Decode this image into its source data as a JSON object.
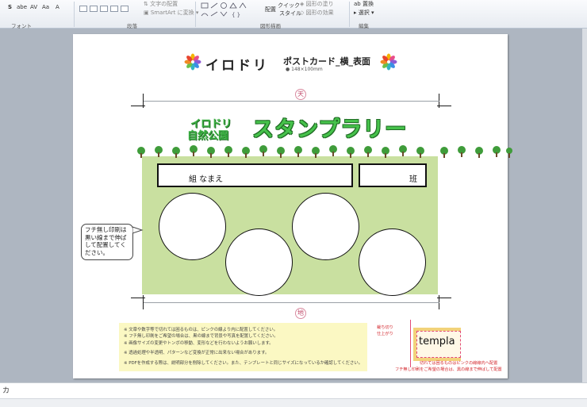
{
  "ribbon": {
    "font_group_label": "フォント",
    "paragraph_group_label": "段落",
    "drawing_group_label": "図形描画",
    "editing_group_label": "編集",
    "text_direction": "文字の配置",
    "smartart": "SmartArt に変換",
    "arrange": "配置",
    "quick_style": "クイック",
    "style_word": "スタイル",
    "shape_fill": "図形の塗り",
    "shape_outline": "図形の枠線",
    "shape_effect": "図形の効果",
    "find": "置換",
    "select": "選択"
  },
  "slide": {
    "brand": "イロドリ",
    "product": "ポストカード_横_表面",
    "size": "148×100mm",
    "top_mark": "天",
    "bottom_mark": "地",
    "park_name_top": "イロドリ",
    "park_name_bottom": "自然公園",
    "rally_title": "スタンプラリー",
    "name_field": "組 なまえ",
    "class_field": "班",
    "borderless_note": "フチ無し印刷は黒い線まで伸ばして配置してください。",
    "notes": [
      "※ 文章や数字等で切れては困るものは、ピンクの線より内に配置してください。",
      "※ フチ無し印刷をご希望の場合は、黒の線まで背景や写真を配置してください。",
      "※ 画像サイズの変更やトンボの移動、変形などを行わないようお願いします。",
      "※ 透過処理や半透明、パターンなど変換が正常に出来ない場合があります。",
      "※ PDFを作成する際は、説明部分を削除してください。また、テンプレートと同じサイズになっているか確認してください。"
    ],
    "template_word": "templa",
    "legend_cut": "裁ち切り",
    "legend_finish": "仕上がり",
    "legend_safe": "切れては困るものはピンクの線線内へ配置",
    "legend_borderless": "フチ無し印刷をご希望の場合は、黒の線まで伸ばして配置"
  },
  "status_char": "カ",
  "colors": {
    "accent_green": "#3cb043",
    "bg_green": "#c9e0a0",
    "guide_pink": "#e24a78"
  }
}
